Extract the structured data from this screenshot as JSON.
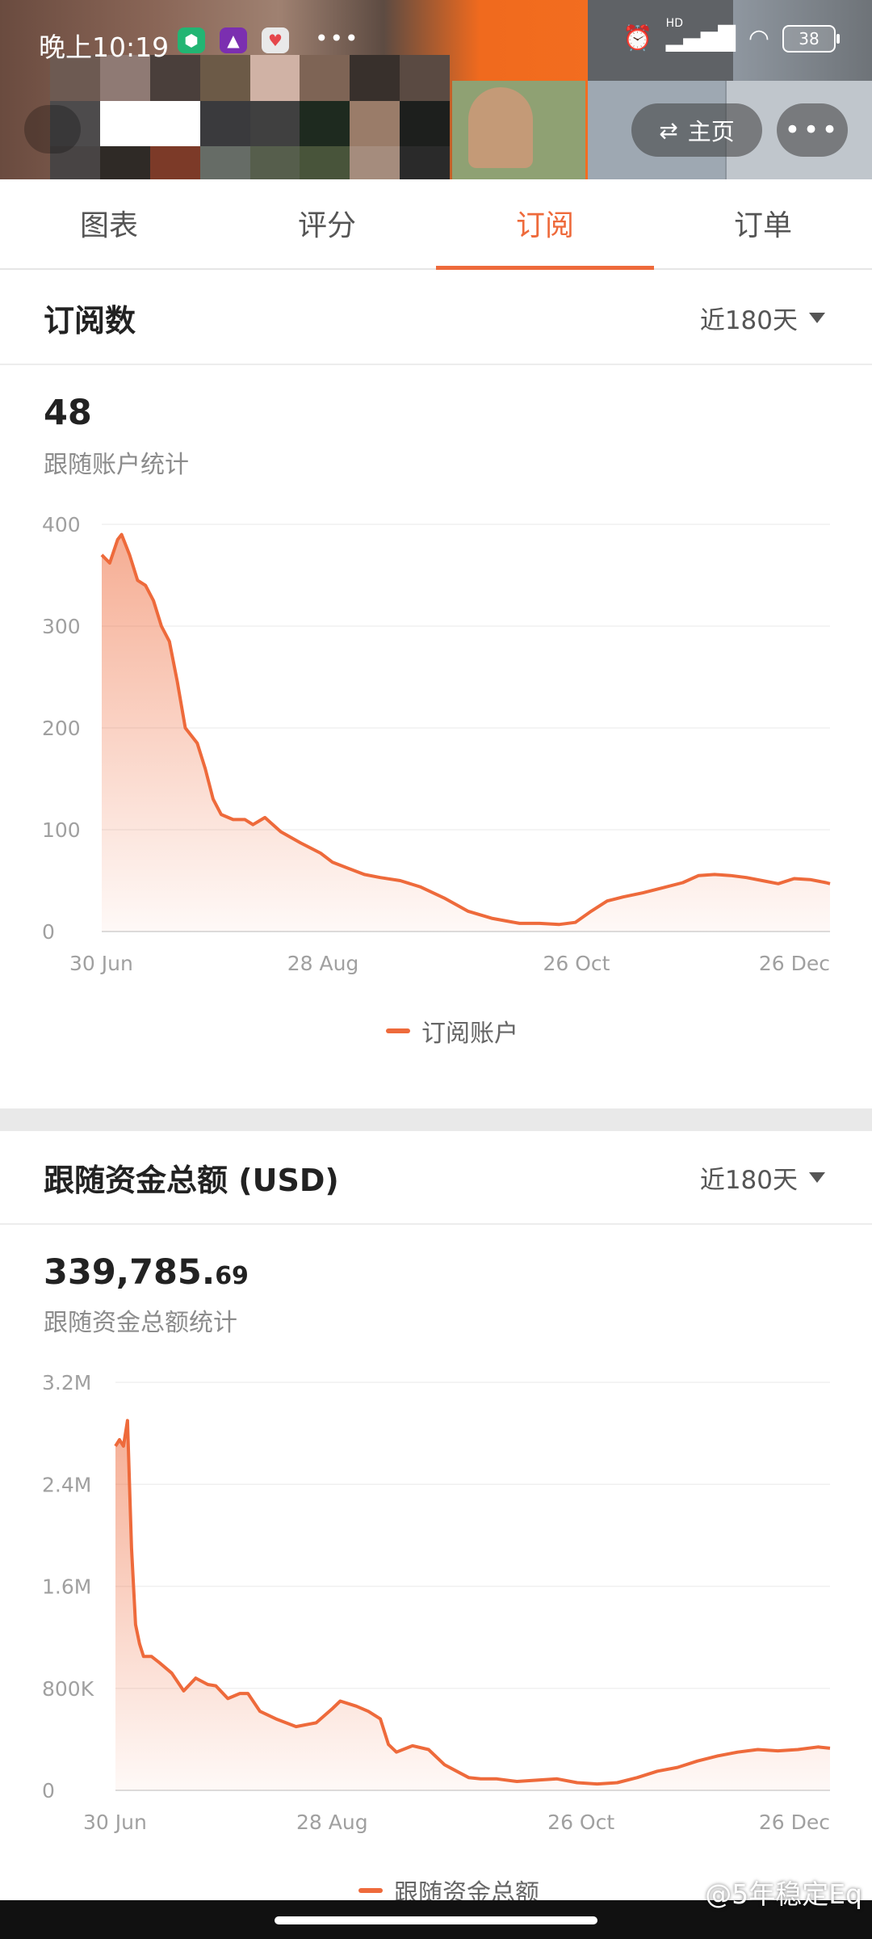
{
  "status_bar": {
    "time": "晚上10:19",
    "battery": "38",
    "hd_label": "HD"
  },
  "header": {
    "home_label": "主页",
    "more_glyph": "•••"
  },
  "tabs": [
    {
      "label": "图表",
      "active": false
    },
    {
      "label": "评分",
      "active": false
    },
    {
      "label": "订阅",
      "active": true
    },
    {
      "label": "订单",
      "active": false
    }
  ],
  "colors": {
    "accent": "#ee6a3b",
    "tab_text": "#555555",
    "muted": "#8c8c8c"
  },
  "sections": [
    {
      "title": "订阅数",
      "range": "近180天",
      "value_main": "48",
      "value_dec": "",
      "subtitle": "跟随账户统计",
      "legend": "订阅账户"
    },
    {
      "title": "跟随资金总额 (USD)",
      "range": "近180天",
      "value_main": "339,785.",
      "value_dec": "69",
      "subtitle": "跟随资金总额统计",
      "legend": "跟随资金总额"
    }
  ],
  "chart_data": [
    {
      "type": "area",
      "title": "",
      "xlabel": "",
      "ylabel": "",
      "x_ticks": [
        "30 Jun",
        "28 Aug",
        "26 Oct",
        "26 Dec"
      ],
      "y_ticks": [
        "400",
        "300",
        "200",
        "100",
        "0"
      ],
      "ylim": [
        0,
        400
      ],
      "grid": true,
      "legend_position": "bottom",
      "series": [
        {
          "name": "订阅账户",
          "x": [
            0,
            2,
            4,
            5,
            7,
            9,
            11,
            13,
            15,
            17,
            19,
            21,
            24,
            26,
            28,
            30,
            33,
            36,
            38,
            41,
            45,
            50,
            55,
            58,
            62,
            66,
            70,
            75,
            80,
            86,
            92,
            98,
            105,
            110,
            115,
            119,
            123,
            127,
            131,
            136,
            141,
            146,
            150,
            154,
            158,
            162,
            166,
            170,
            174,
            178,
            182,
            183
          ],
          "values": [
            370,
            362,
            385,
            390,
            370,
            345,
            340,
            325,
            300,
            285,
            245,
            200,
            185,
            160,
            130,
            115,
            110,
            110,
            105,
            112,
            98,
            87,
            77,
            68,
            62,
            56,
            53,
            50,
            44,
            33,
            20,
            13,
            8,
            8,
            7,
            9,
            20,
            30,
            34,
            38,
            43,
            48,
            55,
            56,
            55,
            53,
            50,
            47,
            52,
            51,
            48,
            47
          ]
        }
      ]
    },
    {
      "type": "area",
      "title": "",
      "xlabel": "",
      "ylabel": "",
      "x_ticks": [
        "30 Jun",
        "28 Aug",
        "26 Oct",
        "26 Dec"
      ],
      "y_ticks": [
        "3.2M",
        "2.4M",
        "1.6M",
        "800K",
        "0"
      ],
      "ylim": [
        0,
        3200000
      ],
      "grid": true,
      "legend_position": "bottom",
      "series": [
        {
          "name": "跟随资金总额",
          "x": [
            0,
            1,
            2,
            3,
            4,
            5,
            6,
            7,
            9,
            11,
            14,
            17,
            20,
            23,
            25,
            28,
            31,
            33,
            36,
            40,
            45,
            50,
            54,
            56,
            58,
            60,
            63,
            66,
            68,
            70,
            74,
            78,
            82,
            85,
            88,
            91,
            95,
            100,
            105,
            110,
            115,
            120,
            125,
            130,
            135,
            140,
            145,
            150,
            155,
            160,
            165,
            170,
            175,
            178
          ],
          "values": [
            2700000,
            2750000,
            2700000,
            2900000,
            1900000,
            1300000,
            1150000,
            1050000,
            1050000,
            1000000,
            920000,
            780000,
            880000,
            830000,
            820000,
            720000,
            760000,
            760000,
            620000,
            560000,
            500000,
            530000,
            640000,
            700000,
            680000,
            660000,
            620000,
            560000,
            360000,
            300000,
            350000,
            320000,
            200000,
            150000,
            100000,
            90000,
            90000,
            70000,
            80000,
            90000,
            60000,
            50000,
            60000,
            100000,
            150000,
            180000,
            230000,
            270000,
            300000,
            320000,
            310000,
            320000,
            340000,
            330000
          ]
        }
      ]
    }
  ],
  "watermark": "@5年稳定Eq"
}
